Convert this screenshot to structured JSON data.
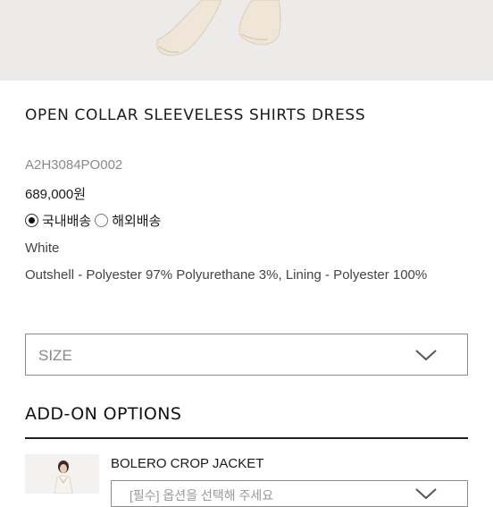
{
  "product": {
    "name": "OPEN COLLAR SLEEVELESS SHIRTS DRESS",
    "sku": "A2H3084PO002",
    "price": "689,000원",
    "shipping_options": [
      {
        "label": "국내배송",
        "selected": true
      },
      {
        "label": "해외배송",
        "selected": false
      }
    ],
    "color": "White",
    "material": "Outshell - Polyester 97% Polyurethane 3%, Lining - Polyester 100%"
  },
  "size_select": {
    "label": "SIZE",
    "icon": "chevron-down-icon"
  },
  "addon": {
    "heading": "ADD-ON OPTIONS",
    "item_name": "BOLERO CROP JACKET",
    "select_placeholder": "[필수] 옵션을 선택해 주세요"
  },
  "colors": {
    "text": "#1a1a1a",
    "muted": "#8a8a8a",
    "border": "#8c8c8c",
    "hero_bg": "#ecebea"
  }
}
